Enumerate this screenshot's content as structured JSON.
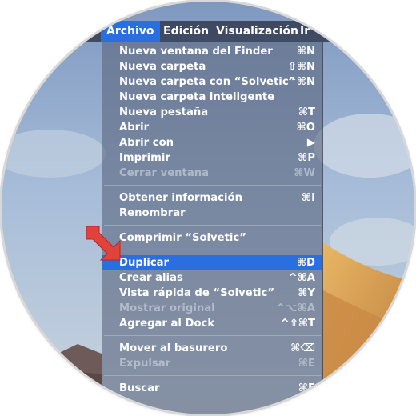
{
  "menubar": {
    "items": [
      "Archivo",
      "Edición",
      "Visualización",
      "Ir"
    ]
  },
  "menu": {
    "items": [
      {
        "label": "Nueva ventana del Finder",
        "shortcut": "⌘N",
        "state": "enabled"
      },
      {
        "label": "Nueva carpeta",
        "shortcut": "⇧⌘N",
        "state": "enabled"
      },
      {
        "label": "Nueva carpeta con “Solvetic”",
        "shortcut": "^⌘N",
        "state": "enabled"
      },
      {
        "label": "Nueva carpeta inteligente",
        "shortcut": "",
        "state": "enabled"
      },
      {
        "label": "Nueva pestaña",
        "shortcut": "⌘T",
        "state": "enabled"
      },
      {
        "label": "Abrir",
        "shortcut": "⌘O",
        "state": "enabled"
      },
      {
        "label": "Abrir con",
        "shortcut": "▶",
        "state": "enabled"
      },
      {
        "label": "Imprimir",
        "shortcut": "⌘P",
        "state": "enabled"
      },
      {
        "label": "Cerrar ventana",
        "shortcut": "⌘W",
        "state": "disabled"
      },
      {
        "label": "Obtener información",
        "shortcut": "⌘I",
        "state": "enabled"
      },
      {
        "label": "Renombrar",
        "shortcut": "",
        "state": "enabled"
      },
      {
        "label": "Comprimir “Solvetic”",
        "shortcut": "",
        "state": "enabled"
      },
      {
        "label": "Duplicar",
        "shortcut": "⌘D",
        "state": "selected"
      },
      {
        "label": "Crear alias",
        "shortcut": "^⌘A",
        "state": "enabled"
      },
      {
        "label": "Vista rápida de “Solvetic”",
        "shortcut": "⌘Y",
        "state": "enabled"
      },
      {
        "label": "Mostrar original",
        "shortcut": "^⌥⌘A",
        "state": "disabled"
      },
      {
        "label": "Agregar al Dock",
        "shortcut": "^⇧⌘T",
        "state": "enabled"
      },
      {
        "label": "Mover al basurero",
        "shortcut": "⌘⌫",
        "state": "enabled"
      },
      {
        "label": "Expulsar",
        "shortcut": "⌘E",
        "state": "disabled"
      },
      {
        "label": "Buscar",
        "shortcut": "⌘F",
        "state": "enabled"
      }
    ]
  },
  "colors": {
    "accent": "#2a6fe0",
    "arrow": "#e0433c",
    "menubar": "#3a425a"
  },
  "icons": {
    "pointer": "red-arrow-icon"
  }
}
